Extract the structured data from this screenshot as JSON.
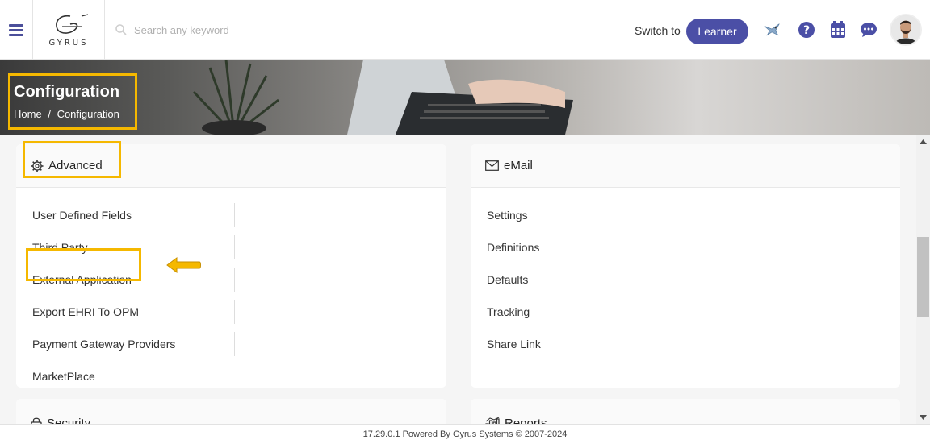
{
  "header": {
    "logo_text": "GYRUS",
    "search_placeholder": "Search any keyword",
    "switch_label": "Switch to",
    "learner_button": "Learner",
    "icons": [
      "menu-icon",
      "bird-icon",
      "help-icon",
      "calendar-icon",
      "chat-icon"
    ],
    "accent_color": "#4b4fa6"
  },
  "banner": {
    "title": "Configuration",
    "breadcrumb": {
      "home": "Home",
      "separator": "/",
      "current": "Configuration"
    }
  },
  "cards": {
    "advanced": {
      "title": "Advanced",
      "items": [
        "User Defined Fields",
        "Third Party",
        "External Application",
        "Export EHRI To OPM",
        "Payment Gateway Providers",
        "MarketPlace"
      ]
    },
    "email": {
      "title": "eMail",
      "items": [
        "Settings",
        "Definitions",
        "Defaults",
        "Tracking",
        "Share Link"
      ]
    },
    "security": {
      "title": "Security"
    },
    "reports": {
      "title": "Reports"
    }
  },
  "highlight_color": "#f5b800",
  "footer": {
    "text": "17.29.0.1 Powered By Gyrus Systems © 2007-2024"
  }
}
